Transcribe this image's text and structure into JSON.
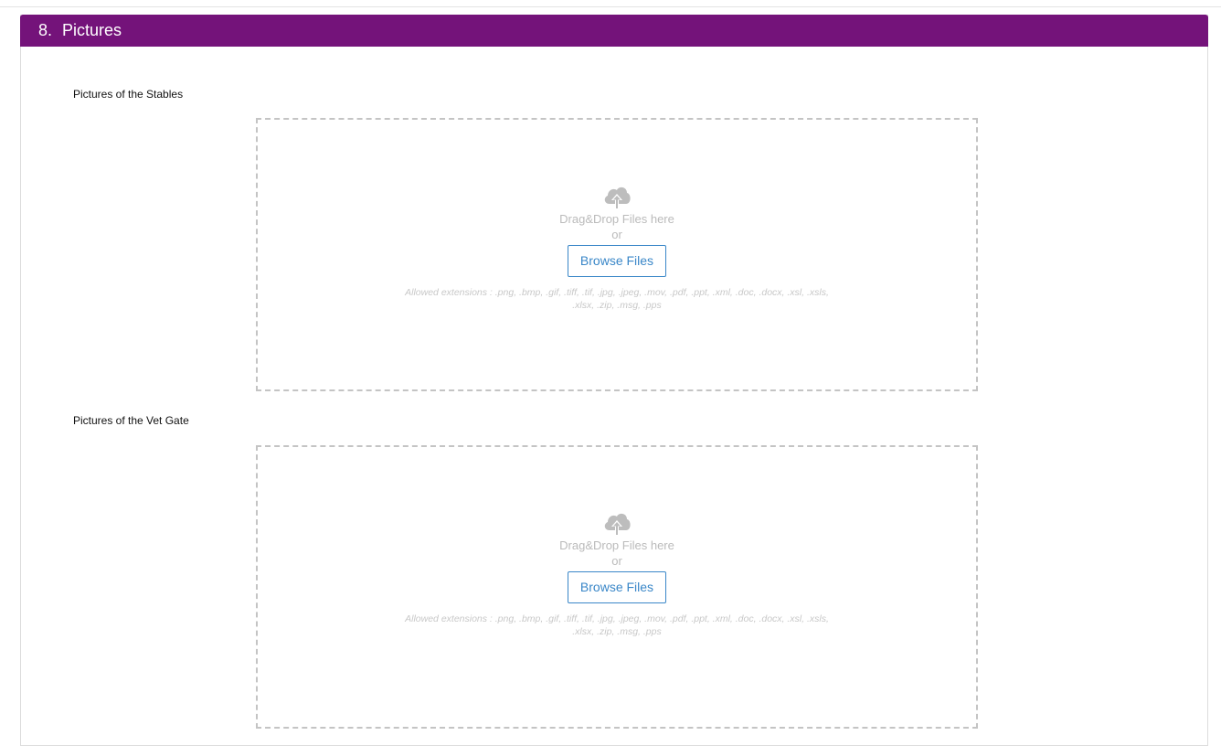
{
  "section": {
    "number": "8.",
    "title": "Pictures"
  },
  "fields": [
    {
      "label": "Pictures of the Stables",
      "dropzone": {
        "drag_text": "Drag&Drop Files here",
        "or_text": "or",
        "browse_label": "Browse Files",
        "extensions_text": "Allowed extensions : .png, .bmp, .gif, .tiff, .tif, .jpg, .jpeg, .mov, .pdf, .ppt, .xml, .doc, .docx, .xsl, .xsls, .xlsx, .zip, .msg, .pps",
        "icon": "cloud-upload-icon"
      }
    },
    {
      "label": "Pictures of the Vet Gate",
      "dropzone": {
        "drag_text": "Drag&Drop Files here",
        "or_text": "or",
        "browse_label": "Browse Files",
        "extensions_text": "Allowed extensions : .png, .bmp, .gif, .tiff, .tif, .jpg, .jpeg, .mov, .pdf, .ppt, .xml, .doc, .docx, .xsl, .xsls, .xlsx, .zip, .msg, .pps",
        "icon": "cloud-upload-icon"
      }
    }
  ],
  "colors": {
    "header_bg": "#74137a",
    "button_blue": "#3a87c8",
    "dashed_border": "#c4c4c4"
  }
}
